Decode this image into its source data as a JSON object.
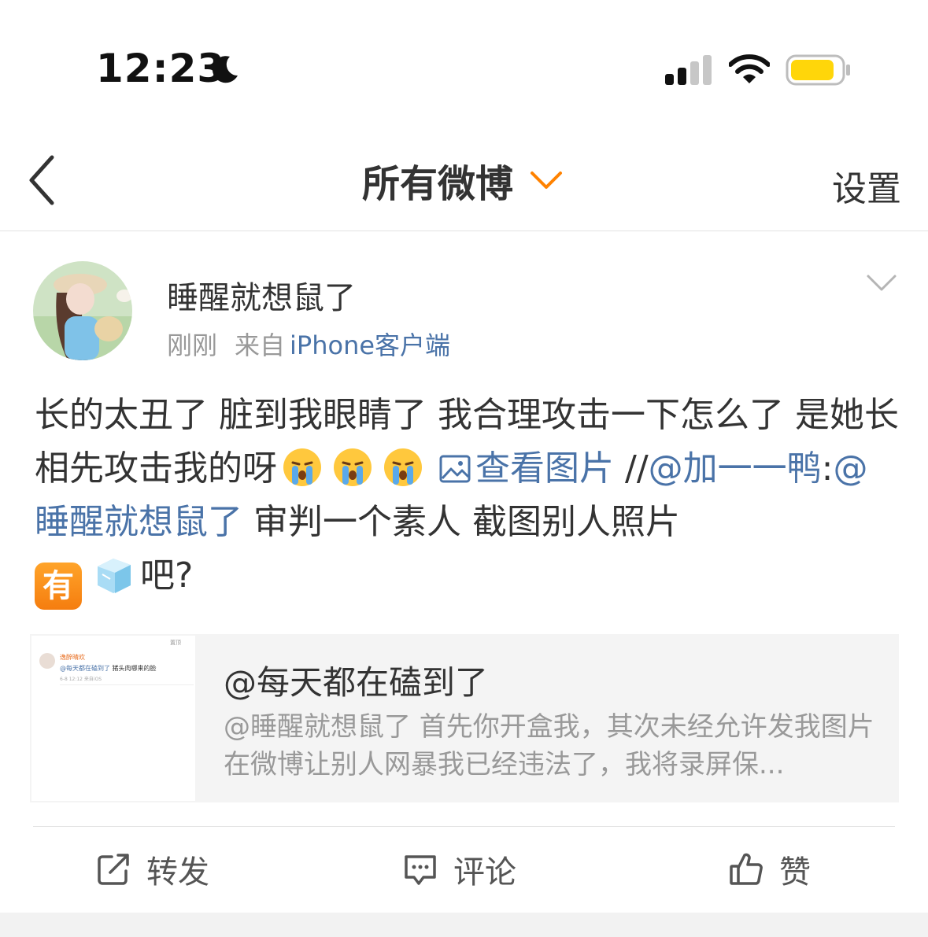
{
  "status_bar": {
    "time": "12:23",
    "icons": [
      "moon-icon",
      "cellular-signal-icon",
      "wifi-icon",
      "battery-icon"
    ],
    "battery_color": "#ffd60a"
  },
  "nav": {
    "back_icon": "chevron-left-icon",
    "title": "所有微博",
    "title_dropdown_icon": "chevron-down-icon",
    "dropdown_color": "#ff8200",
    "settings_label": "设置"
  },
  "post": {
    "username": "睡醒就想鼠了",
    "time": "刚刚",
    "source_prefix": "来自",
    "source": "iPhone客户端",
    "body": {
      "text_1": "长的太丑了 脏到我眼睛了 我合理攻击一下怎么了 是她长相先攻击我的呀",
      "emoji": [
        "crying-face-emoji",
        "crying-face-emoji",
        "crying-face-emoji"
      ],
      "view_image_label": "查看图片",
      "repost_prefix": "//",
      "repost_user": "@加一一鸭",
      "colon": ":",
      "mention": "@睡醒就想鼠了",
      "text_2": " 审判一个素人 截图别人照片",
      "you_emoji": "有",
      "ice_emoji": "ice-cube-emoji",
      "text_3": "吧?"
    },
    "link_color": "#4a73a8"
  },
  "quote_card": {
    "title": "@每天都在磕到了",
    "text": "@睡醒就想鼠了 首先你开盒我，其次未经允许发我图片在微博让别人网暴我已经违法了，我将录屏保...",
    "thumbnail": {
      "name": "逸醉晴欢",
      "top_label": "置顶",
      "body_mention": "@每天都在磕到了",
      "body_text": " 猪头肉哪来的脸",
      "date": "6-8 12:12 来自iOS"
    }
  },
  "actions": {
    "repost_label": "转发",
    "comment_label": "评论",
    "like_label": "赞"
  }
}
